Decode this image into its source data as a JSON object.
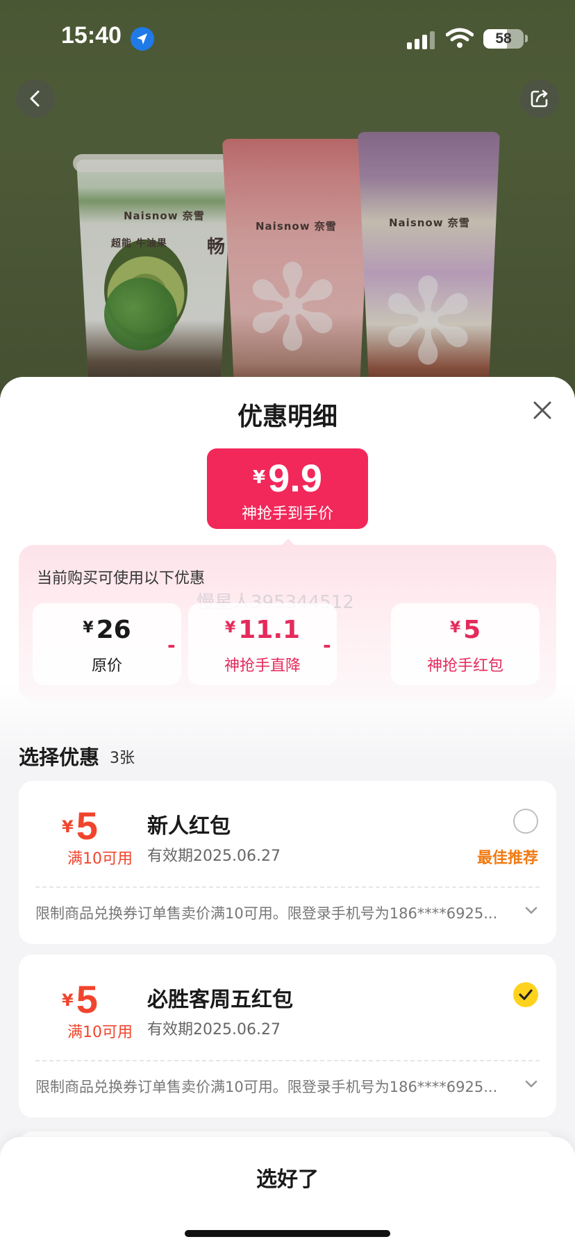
{
  "status_bar": {
    "time": "15:40",
    "battery": "58",
    "battery_level": 0.58
  },
  "hero": {
    "brand": "Naisnow 奈雪",
    "cup_label_1": "超能 牛油果",
    "cup_label_2": "畅"
  },
  "sheet": {
    "title": "优惠明细",
    "final_price": {
      "symbol": "¥",
      "value": "9.9",
      "label": "神抢手到手价"
    },
    "calc": {
      "hint": "当前购买可使用以下优惠",
      "watermark": "慢星人395344512",
      "items": [
        {
          "symbol": "¥",
          "value": "26",
          "label": "原价"
        },
        {
          "symbol": "¥",
          "value": "11.1",
          "label": "神抢手直降"
        },
        {
          "symbol": "¥",
          "value": "5",
          "label": "神抢手红包"
        }
      ],
      "operator": "-"
    },
    "section": {
      "title": "选择优惠",
      "count": "3张"
    },
    "coupons": [
      {
        "symbol": "¥",
        "amount": "5",
        "condition": "满10可用",
        "name": "新人红包",
        "expire": "有效期2025.06.27",
        "badge": "最佳推荐",
        "selected": false,
        "desc": "限制商品兑换券订单售卖价满10可用。限登录手机号为186****6925..."
      },
      {
        "symbol": "¥",
        "amount": "5",
        "condition": "满10可用",
        "name": "必胜客周五红包",
        "expire": "有效期2025.06.27",
        "badge": "",
        "selected": true,
        "desc": "限制商品兑换券订单售卖价满10可用。限登录手机号为186****6925..."
      }
    ],
    "confirm_label": "选好了"
  },
  "colors": {
    "accent_pink": "#f2285a",
    "coupon_red": "#f0452d",
    "recommend_orange": "#f07a12",
    "check_yellow": "#ffd31d"
  },
  "icons": [
    "location-arrow-icon",
    "signal-icon",
    "wifi-icon",
    "battery-icon",
    "back-chevron-icon",
    "share-icon",
    "close-icon",
    "chevron-down-icon",
    "checkmark-icon"
  ]
}
